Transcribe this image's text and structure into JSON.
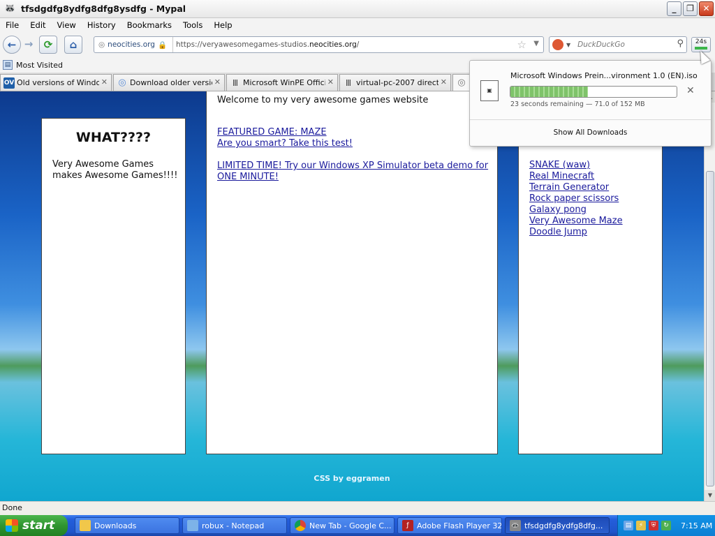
{
  "window": {
    "title": "tfsdgdfg8ydfg8dfg8ysdfg - Mypal",
    "controls": {
      "minimize": "_",
      "maximize": "❐",
      "close": "✕"
    }
  },
  "menu": [
    "File",
    "Edit",
    "View",
    "History",
    "Bookmarks",
    "Tools",
    "Help"
  ],
  "navbar": {
    "site_identity": "neocities.org",
    "url_prefix": "https://veryawesomegames-studios.",
    "url_domain": "neocities.org",
    "url_suffix": "/",
    "search_placeholder": "DuckDuckGo",
    "download_badge": "24s"
  },
  "bookmarks": {
    "most_visited": "Most Visited"
  },
  "tabs": [
    {
      "label": "Old versions of Windo...",
      "icon_text": "OV",
      "icon_color": "#1f5fa8"
    },
    {
      "label": "Download older versio...",
      "icon_text": "◎",
      "icon_color": "#5b8dd6"
    },
    {
      "label": "Microsoft WinPE Offici...",
      "icon_text": "Ⅲ",
      "icon_color": "#444444"
    },
    {
      "label": "virtual-pc-2007 directo...",
      "icon_text": "Ⅲ",
      "icon_color": "#444444"
    },
    {
      "label": "",
      "icon_text": "◎",
      "icon_color": "#777777"
    }
  ],
  "page": {
    "left_panel": {
      "title": "WHAT????",
      "body": "Very Awesome Games makes Awesome Games!!!!"
    },
    "middle_panel": {
      "welcome": "Welcome to my very awesome games website",
      "links": [
        "FEATURED GAME: MAZE",
        "Are you smart? Take this test!",
        "LIMITED TIME! Try our Windows XP Simulator beta demo for ONE MINUTE!"
      ]
    },
    "right_panel": {
      "games": [
        "SNAKE (waw)",
        "Real Minecraft",
        "Terrain Generator",
        "Rock paper scissors",
        "Galaxy pong",
        "Very Awesome Maze",
        "Doodle Jump"
      ]
    },
    "footer": "CSS by eggramen"
  },
  "status": "Done",
  "downloads_popup": {
    "file_name": "Microsoft Windows Prein...vironment 1.0 (EN).iso",
    "progress_percent": 46.7,
    "status_text": "23 seconds remaining — 71.0 of 152 MB",
    "show_all": "Show All Downloads",
    "cancel": "✕"
  },
  "taskbar": {
    "start": "start",
    "items": [
      {
        "label": "Downloads",
        "icon_color": "#f1c74a"
      },
      {
        "label": "robux - Notepad",
        "icon_color": "#7db3e8"
      },
      {
        "label": "New Tab - Google C...",
        "icon_color": "#e9b53c"
      },
      {
        "label": "Adobe Flash Player 32",
        "icon_color": "#b22222"
      },
      {
        "label": "tfsdgdfg8ydfg8dfg...",
        "icon_color": "#888888"
      }
    ],
    "clock": "7:15 AM"
  }
}
